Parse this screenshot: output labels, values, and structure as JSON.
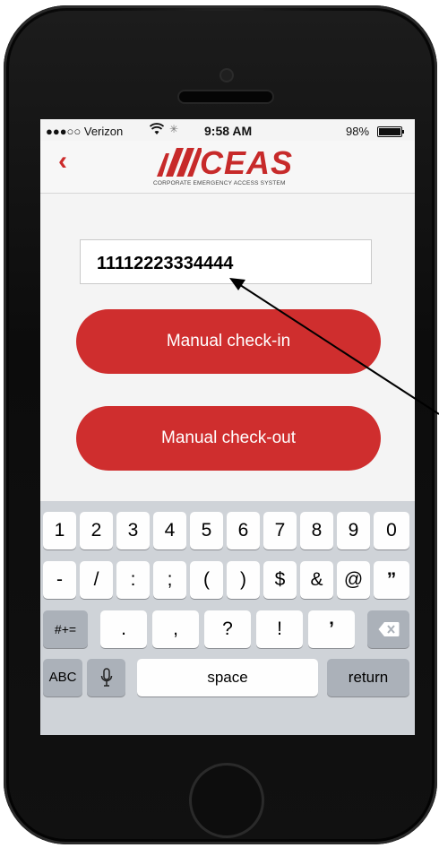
{
  "status_bar": {
    "carrier": "●●●○○ Verizon",
    "wifi_icon": "wifi-icon",
    "activity_icon": "spinner-icon",
    "time": "9:58 AM",
    "battery": "98%",
    "battery_level": 0.98
  },
  "nav": {
    "back_icon": "chevron-left-icon",
    "back_glyph": "‹",
    "logo_word": "CEAS",
    "logo_tagline": "CORPORATE EMERGENCY ACCESS SYSTEM",
    "brand_color": "#cf2e2e"
  },
  "form": {
    "code_value": "11112223334444",
    "checkin_label": "Manual check-in",
    "checkout_label": "Manual check-out"
  },
  "keyboard": {
    "row1": [
      "1",
      "2",
      "3",
      "4",
      "5",
      "6",
      "7",
      "8",
      "9",
      "0"
    ],
    "row2": [
      "-",
      "/",
      ":",
      ";",
      "(",
      ")",
      "$",
      "&",
      "@",
      "”"
    ],
    "row3_mode": "#+=",
    "row3": [
      ".",
      ",",
      "?",
      "!",
      "’"
    ],
    "delete_icon": "backspace-icon",
    "abc": "ABC",
    "mic_icon": "microphone-icon",
    "space": "space",
    "return": "return"
  }
}
